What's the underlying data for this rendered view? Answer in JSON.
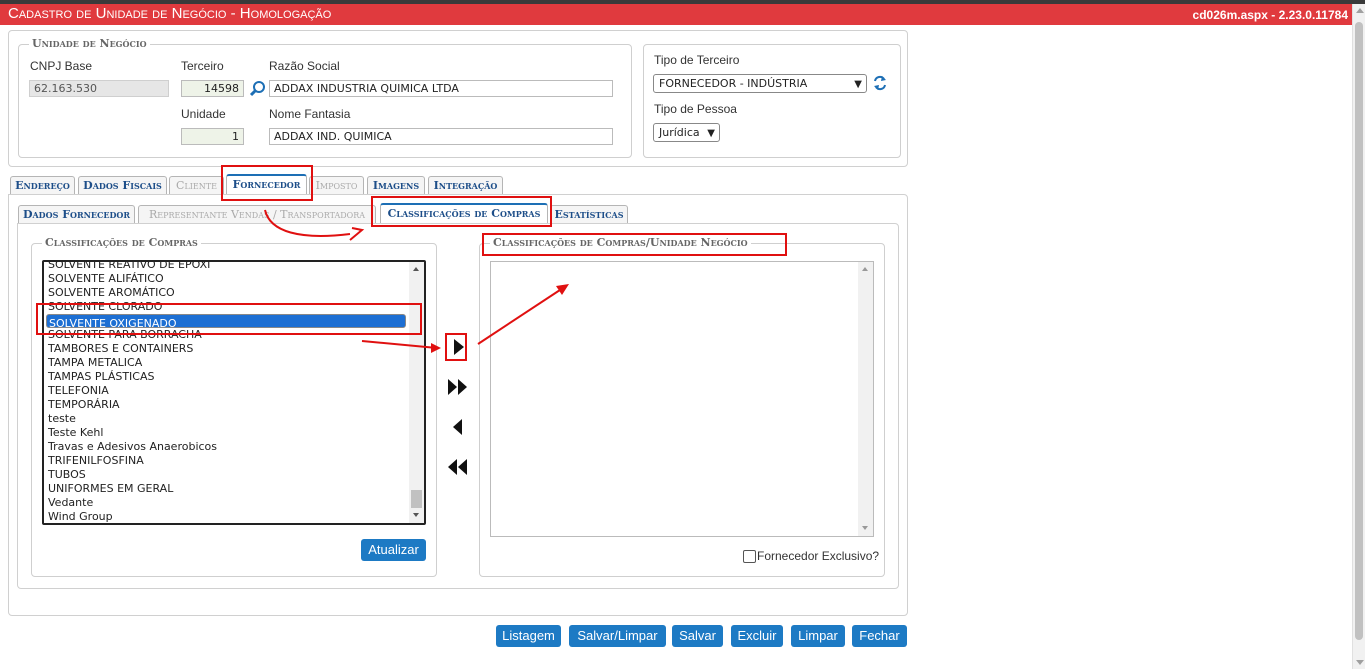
{
  "window": {
    "title": "Cadastro de Unidade de Negócio  - Homologação",
    "version": "cd026m.aspx - 2.23.0.11784"
  },
  "unidade": {
    "legend": "Unidade de Negócio",
    "cnpj_label": "CNPJ Base",
    "cnpj_value": "62.163.530",
    "terceiro_label": "Terceiro",
    "terceiro_value": "14598",
    "razao_label": "Razão Social",
    "razao_value": "ADDAX INDUSTRIA QUIMICA LTDA",
    "unidade_label": "Unidade",
    "unidade_value": "1",
    "fantasia_label": "Nome Fantasia",
    "fantasia_value": "ADDAX IND. QUIMICA"
  },
  "tipo": {
    "terceiro_label": "Tipo de Terceiro",
    "terceiro_value": "FORNECEDOR - INDÚSTRIA",
    "pessoa_label": "Tipo de Pessoa",
    "pessoa_value": "Jurídica"
  },
  "tabs": [
    "Endereço",
    "Dados Fiscais",
    "Cliente",
    "Fornecedor",
    "Imposto",
    "Imagens",
    "Integração"
  ],
  "subtabs": [
    "Dados Fornecedor",
    "Representante Vendas / Transportadora",
    "Classificações de Compras",
    "Estatísticas"
  ],
  "classificacoes": {
    "legend": "Classificações de Compras",
    "items": [
      "SOLVENTE REATIVO DE EPOXI",
      "SOLVENTE ALIFÁTICO",
      "SOLVENTE AROMÁTICO",
      "SOLVENTE CLORADO",
      "SOLVENTE OXIGENADO",
      "SOLVENTE PARA BORRACHA",
      "TAMBORES E CONTAINERS",
      "TAMPA METALICA",
      "TAMPAS PLÁSTICAS",
      "TELEFONIA",
      "TEMPORÁRIA",
      "teste",
      "Teste Kehl",
      "Travas e Adesivos Anaerobicos",
      "TRIFENILFOSFINA",
      "TUBOS",
      "UNIFORMES EM GERAL",
      "Vedante",
      "Wind Group"
    ],
    "selected": "SOLVENTE OXIGENADO",
    "update_button": "Atualizar"
  },
  "unidade_classificacoes": {
    "legend": "Classificações de Compras/Unidade Negócio",
    "exclusive_label": "Fornecedor Exclusivo?"
  },
  "footer_buttons": [
    "Listagem",
    "Salvar/Limpar",
    "Salvar",
    "Excluir",
    "Limpar",
    "Fechar"
  ],
  "colors": {
    "title_bar": "#e03a3e",
    "button": "#1d7ac4",
    "annotation": "#e01010",
    "selection": "#1d6fd3"
  }
}
